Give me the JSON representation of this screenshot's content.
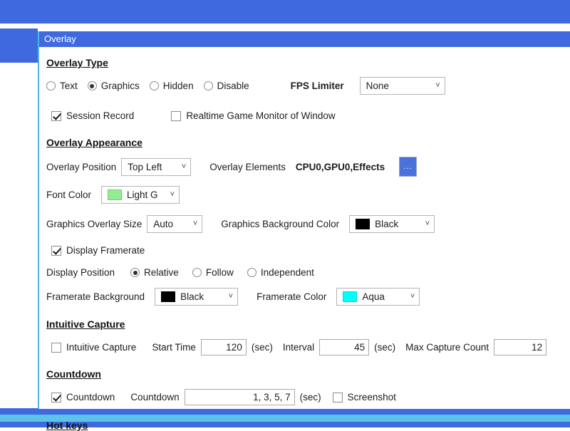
{
  "window": {
    "panel_title": "Overlay"
  },
  "overlay_type": {
    "heading": "Overlay Type",
    "options": [
      {
        "label": "Text",
        "selected": false
      },
      {
        "label": "Graphics",
        "selected": true
      },
      {
        "label": "Hidden",
        "selected": false
      },
      {
        "label": "Disable",
        "selected": false
      }
    ],
    "fps_limiter_label": "FPS Limiter",
    "fps_limiter_value": "None",
    "session_record_label": "Session Record",
    "session_record_checked": true,
    "realtime_monitor_label": "Realtime Game Monitor of Window",
    "realtime_monitor_checked": false
  },
  "overlay_appearance": {
    "heading": "Overlay Appearance",
    "overlay_position_label": "Overlay Position",
    "overlay_position_value": "Top Left",
    "overlay_elements_label": "Overlay Elements",
    "overlay_elements_value": "CPU0,GPU0,Effects",
    "elements_button_label": "...",
    "font_color_label": "Font Color",
    "font_color_value": "Light G",
    "font_color_swatch": "#90EE90",
    "graphics_overlay_size_label": "Graphics Overlay Size",
    "graphics_overlay_size_value": "Auto",
    "graphics_background_color_label": "Graphics Background Color",
    "graphics_background_color_value": "Black",
    "graphics_background_swatch": "#000000",
    "display_framerate_label": "Display Framerate",
    "display_framerate_checked": true,
    "display_position_label": "Display Position",
    "display_position_options": [
      {
        "label": "Relative",
        "selected": true
      },
      {
        "label": "Follow",
        "selected": false
      },
      {
        "label": "Independent",
        "selected": false
      }
    ],
    "framerate_background_label": "Framerate Background",
    "framerate_background_value": "Black",
    "framerate_background_swatch": "#000000",
    "framerate_color_label": "Framerate Color",
    "framerate_color_value": "Aqua",
    "framerate_color_swatch": "#00FFFF"
  },
  "intuitive_capture": {
    "heading": "Intuitive Capture",
    "enable_label": "Intuitive Capture",
    "enable_checked": false,
    "start_time_label": "Start Time",
    "start_time_value": "120",
    "start_time_unit": "(sec)",
    "interval_label": "Interval",
    "interval_value": "45",
    "interval_unit": "(sec)",
    "max_capture_count_label": "Max Capture Count",
    "max_capture_count_value": "12"
  },
  "countdown": {
    "heading": "Countdown",
    "enable_label": "Countdown",
    "enable_checked": true,
    "field_label": "Countdown",
    "field_value": "1, 3, 5, 7",
    "unit": "(sec)",
    "screenshot_label": "Screenshot",
    "screenshot_checked": false
  },
  "hot_keys": {
    "heading": "Hot keys"
  },
  "colors": {
    "accent_blue": "#3f6adf",
    "accent_cyan": "#5bc4e8"
  }
}
